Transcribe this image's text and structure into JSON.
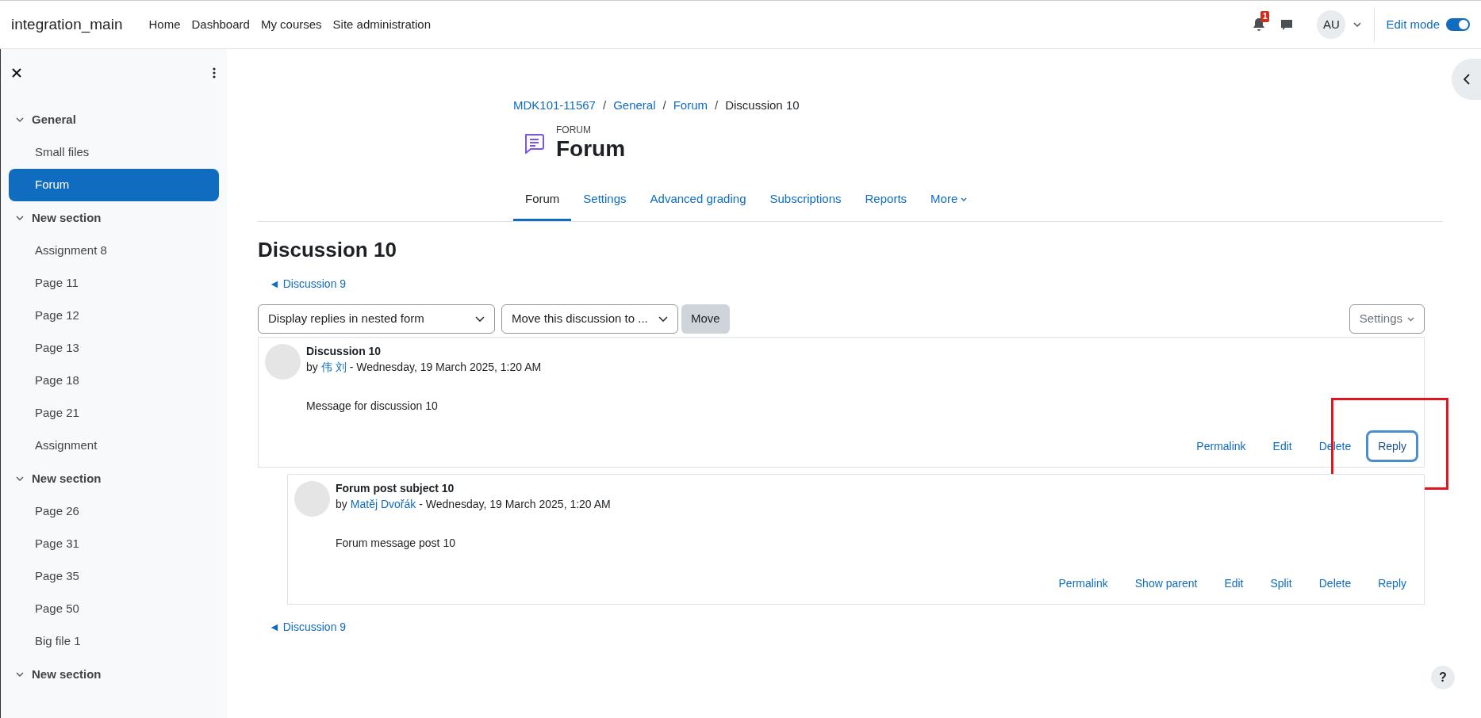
{
  "navbar": {
    "site_name": "integration_main",
    "links": [
      "Home",
      "Dashboard",
      "My courses",
      "Site administration"
    ],
    "notification_count": "1",
    "avatar_initials": "AU",
    "edit_mode": {
      "label": "Edit mode",
      "on": true
    }
  },
  "drawer": {
    "sections": [
      {
        "title": "General",
        "expanded": true,
        "items": [
          {
            "label": "Small files",
            "selected": false
          },
          {
            "label": "Forum",
            "selected": true
          }
        ]
      },
      {
        "title": "New section",
        "expanded": true,
        "items": [
          {
            "label": "Assignment 8",
            "selected": false
          },
          {
            "label": "Page 11",
            "selected": false
          },
          {
            "label": "Page 12",
            "selected": false
          },
          {
            "label": "Page 13",
            "selected": false
          },
          {
            "label": "Page 18",
            "selected": false
          },
          {
            "label": "Page 21",
            "selected": false
          },
          {
            "label": "Assignment",
            "selected": false
          }
        ]
      },
      {
        "title": "New section",
        "expanded": true,
        "items": [
          {
            "label": "Page 26",
            "selected": false
          },
          {
            "label": "Page 31",
            "selected": false
          },
          {
            "label": "Page 35",
            "selected": false
          },
          {
            "label": "Page 50",
            "selected": false
          },
          {
            "label": "Big file 1",
            "selected": false
          }
        ]
      },
      {
        "title": "New section",
        "expanded": true
      }
    ]
  },
  "breadcrumb_separator": "/",
  "breadcrumb": [
    {
      "label": "MDK101-11567",
      "link": true
    },
    {
      "label": "General",
      "link": true
    },
    {
      "label": "Forum",
      "link": true
    },
    {
      "label": "Discussion 10",
      "link": false
    }
  ],
  "activity": {
    "type_label": "FORUM",
    "title": "Forum"
  },
  "tabs": [
    {
      "label": "Forum",
      "selected": true,
      "dropdown": false
    },
    {
      "label": "Settings",
      "selected": false,
      "dropdown": false
    },
    {
      "label": "Advanced grading",
      "selected": false,
      "dropdown": false
    },
    {
      "label": "Subscriptions",
      "selected": false,
      "dropdown": false
    },
    {
      "label": "Reports",
      "selected": false,
      "dropdown": false
    },
    {
      "label": "More",
      "selected": false,
      "dropdown": true
    }
  ],
  "discussion": {
    "title": "Discussion 10",
    "prev_link_top": "◄ Discussion 9",
    "prev_link_bottom": "◄ Discussion 9",
    "display_select": "Display replies in nested form",
    "move_select": "Move this discussion to ...",
    "move_button": "Move",
    "settings_button": "Settings",
    "posts": [
      {
        "subject": "Discussion 10",
        "by": "by",
        "author": "伟 刘",
        "date": "- Wednesday, 19 March 2025, 1:20 AM",
        "message": "Message for discussion 10",
        "highlighted": true,
        "actions": [
          {
            "label": "Permalink",
            "focused": false
          },
          {
            "label": "Edit",
            "focused": false
          },
          {
            "label": "Delete",
            "focused": false
          },
          {
            "label": "Reply",
            "focused": true
          }
        ],
        "replies": [
          {
            "subject": "Forum post subject 10",
            "by": "by",
            "author": "Matěj Dvořák",
            "date": "- Wednesday, 19 March 2025, 1:20 AM",
            "message": "Forum message post 10",
            "highlighted": false,
            "actions": [
              {
                "label": "Permalink",
                "focused": false
              },
              {
                "label": "Show parent",
                "focused": false
              },
              {
                "label": "Edit",
                "focused": false
              },
              {
                "label": "Split",
                "focused": false
              },
              {
                "label": "Delete",
                "focused": false
              },
              {
                "label": "Reply",
                "focused": false
              }
            ]
          }
        ]
      }
    ]
  },
  "help_button": "?"
}
